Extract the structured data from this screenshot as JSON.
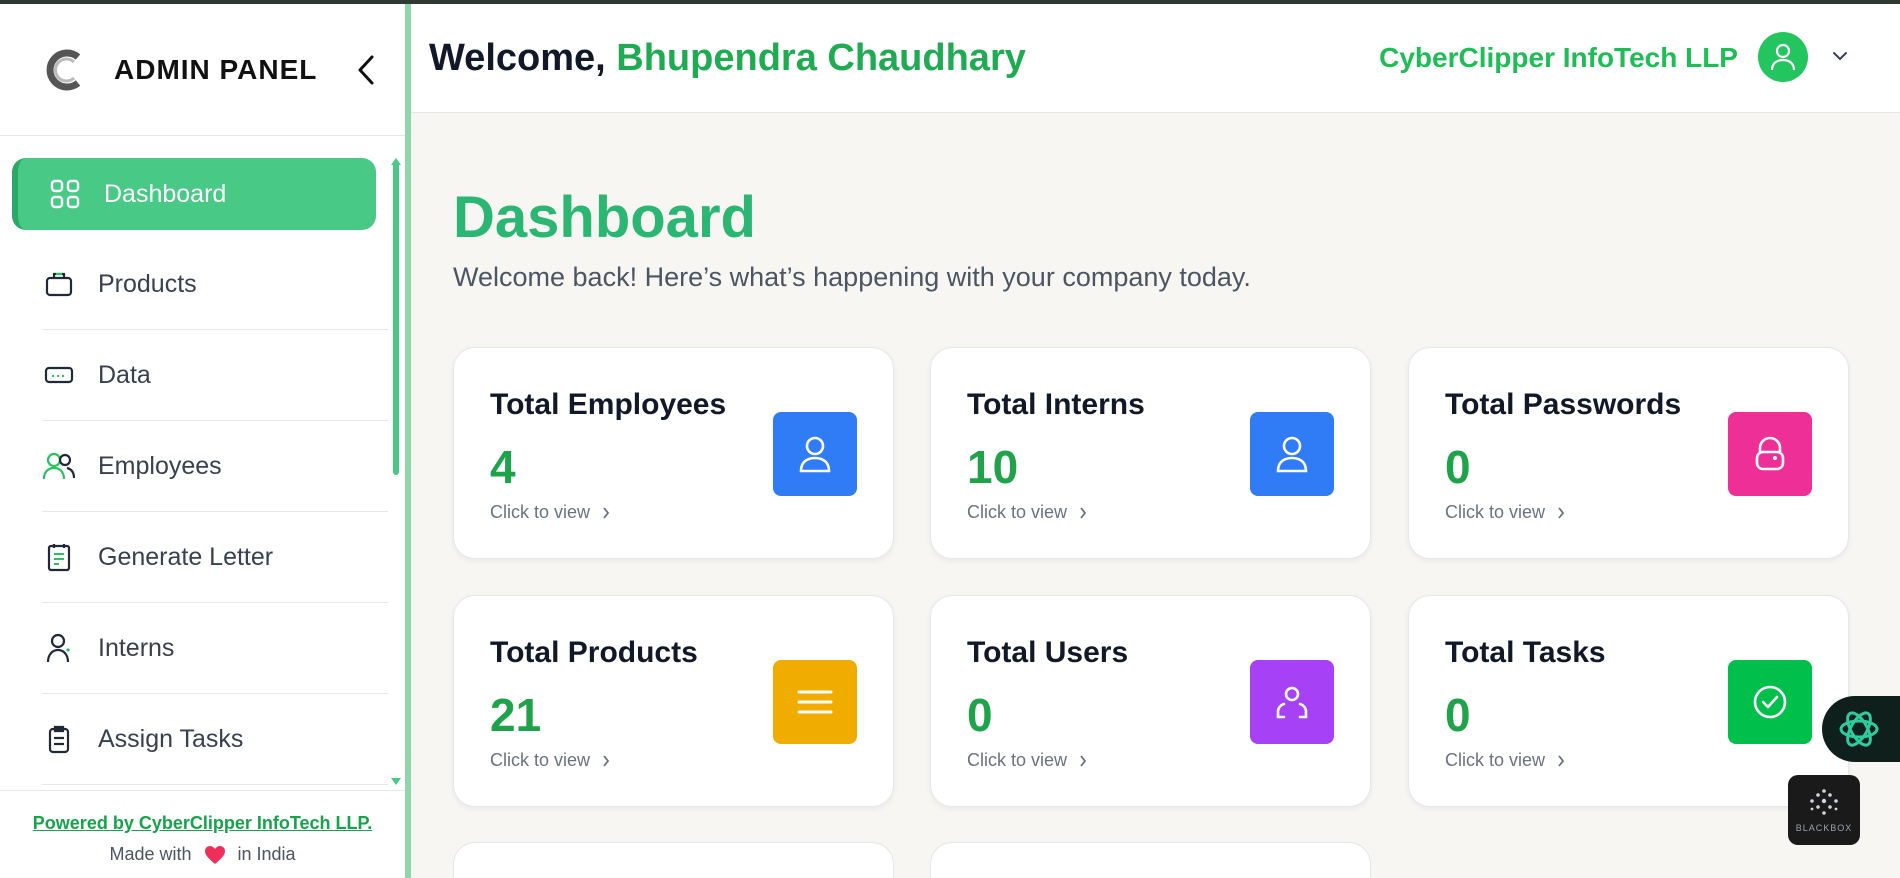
{
  "sidebar": {
    "brand_title": "ADMIN PANEL",
    "items": [
      {
        "label": "Dashboard",
        "icon": "grid-icon",
        "active": true
      },
      {
        "label": "Products",
        "icon": "briefcase-icon"
      },
      {
        "label": "Data",
        "icon": "card-icon"
      },
      {
        "label": "Employees",
        "icon": "users-icon"
      },
      {
        "label": "Generate Letter",
        "icon": "document-icon"
      },
      {
        "label": "Interns",
        "icon": "user-icon"
      },
      {
        "label": "Assign Tasks",
        "icon": "clipboard-icon"
      }
    ],
    "footer": {
      "powered": "Powered by CyberClipper InfoTech LLP.",
      "made_prefix": "Made with",
      "made_suffix": "in India"
    }
  },
  "header": {
    "welcome_prefix": "Welcome,",
    "user_name": "Bhupendra Chaudhary",
    "company": "CyberClipper InfoTech LLP"
  },
  "main": {
    "title": "Dashboard",
    "subtitle": "Welcome back! Here’s what’s happening with your company today.",
    "cards": [
      {
        "title": "Total Employees",
        "value": "4",
        "link": "Click to view",
        "icon": "user-icon",
        "color": "#2f7cf6"
      },
      {
        "title": "Total Interns",
        "value": "10",
        "link": "Click to view",
        "icon": "user-icon",
        "color": "#2f7cf6"
      },
      {
        "title": "Total Passwords",
        "value": "0",
        "link": "Click to view",
        "icon": "lock-icon",
        "color": "#ef2f98"
      },
      {
        "title": "Total Products",
        "value": "21",
        "link": "Click to view",
        "icon": "menu-icon",
        "color": "#f0ad00"
      },
      {
        "title": "Total Users",
        "value": "0",
        "link": "Click to view",
        "icon": "user-scan-icon",
        "color": "#a741f5"
      },
      {
        "title": "Total Tasks",
        "value": "0",
        "link": "Click to view",
        "icon": "check-circle-icon",
        "color": "#00c04b"
      }
    ]
  },
  "widgets": {
    "blackbox_label": "BLACKBOX"
  },
  "colors": {
    "accent": "#48c985",
    "brand_green": "#1fab52",
    "background": "#f7f6f2"
  }
}
